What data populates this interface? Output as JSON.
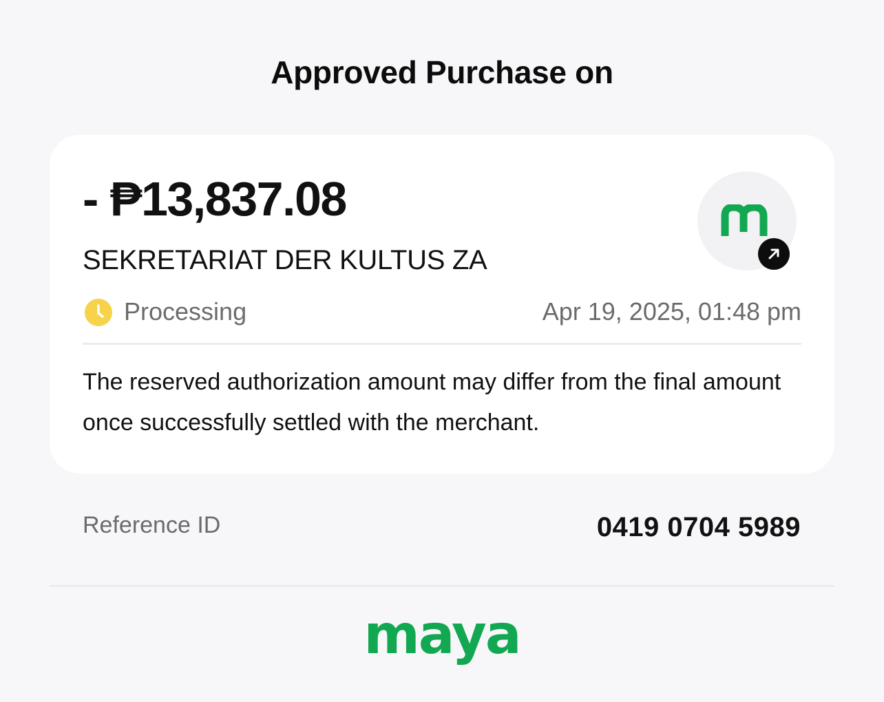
{
  "header": {
    "title": "Approved Purchase on"
  },
  "transaction": {
    "amount": "- ₱13,837.08",
    "merchant": "SEKRETARIAT DER KULTUS ZA",
    "status": "Processing",
    "date": "Apr 19, 2025, 01:48 pm",
    "note": "The reserved authorization amount may differ from the final amount once successfully settled with the merchant.",
    "logo_icon": "maya-m-logo-icon",
    "badge_icon": "arrow-up-right-icon",
    "status_icon": "clock-icon"
  },
  "reference": {
    "label": "Reference ID",
    "value": "0419 0704 5989"
  },
  "footer": {
    "brand": "maya"
  },
  "colors": {
    "background": "#f7f7f9",
    "card": "#ffffff",
    "brand_green": "#12a751",
    "status_yellow": "#f6d34b",
    "muted_text": "#6b6b6b",
    "primary_text": "#111111"
  }
}
